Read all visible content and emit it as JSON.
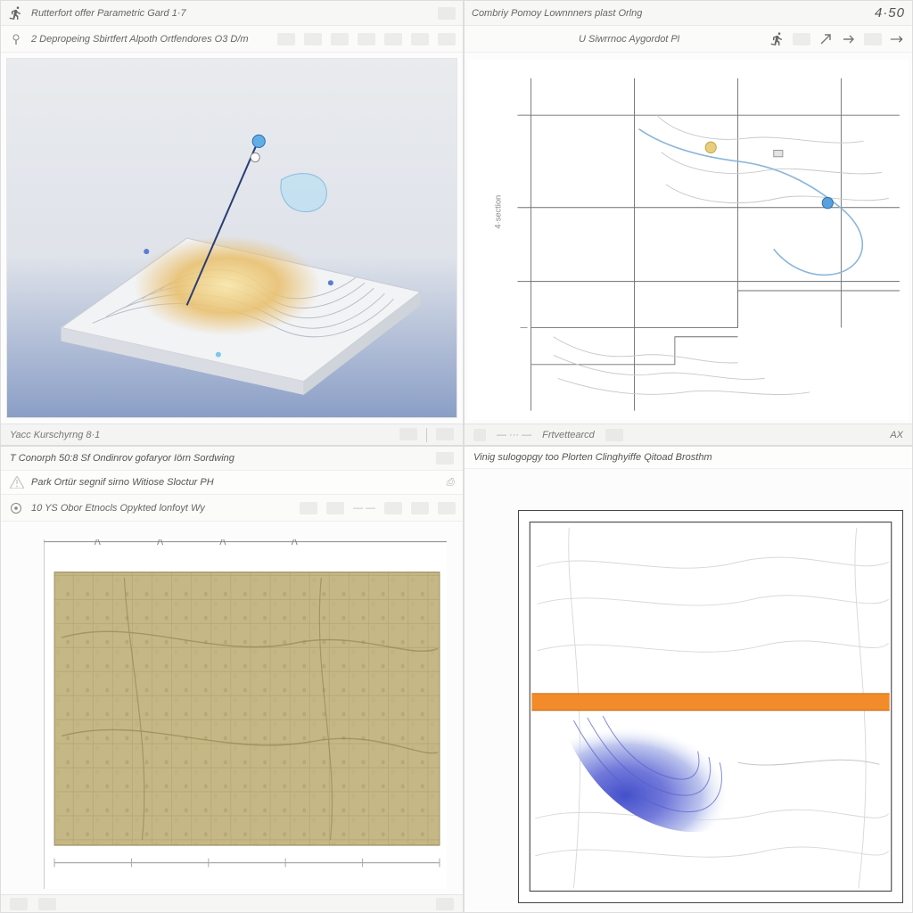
{
  "colors": {
    "accent_orange": "#f28c2a",
    "accent_blue": "#4a7acb",
    "terrain_amber": "#e8c070"
  },
  "tl": {
    "title": "Rutterfort offer Parametric Gard 1·7",
    "toolbar_label": "2 Depropeing Sbirtfert Alpoth Ortfendores O3 D/m",
    "status_label": "Yacc Kurschyrng 8·1"
  },
  "tr": {
    "title": "Combriy    Pomoy Lownnners plast Orlng",
    "title_right": "4·50",
    "toolbar_label": "U Siwrrnoc Aygordot Pl",
    "status_tool": "Frtvettearcd",
    "status_ax": "AX"
  },
  "bl": {
    "header": "T Conorph 50:8 Sf Ondinrov gofaryor Iörn Sordwing",
    "warn_row_label": "Park Ortür segnif sirno Witiose Sloctur PH",
    "toolbar_label": "10 YS Obor Etnocls Opykted lonfoyt Wy"
  },
  "br": {
    "header": "Vinig sulogopgy too Plorten Clinghyiffe Qitoad Brosthm"
  }
}
